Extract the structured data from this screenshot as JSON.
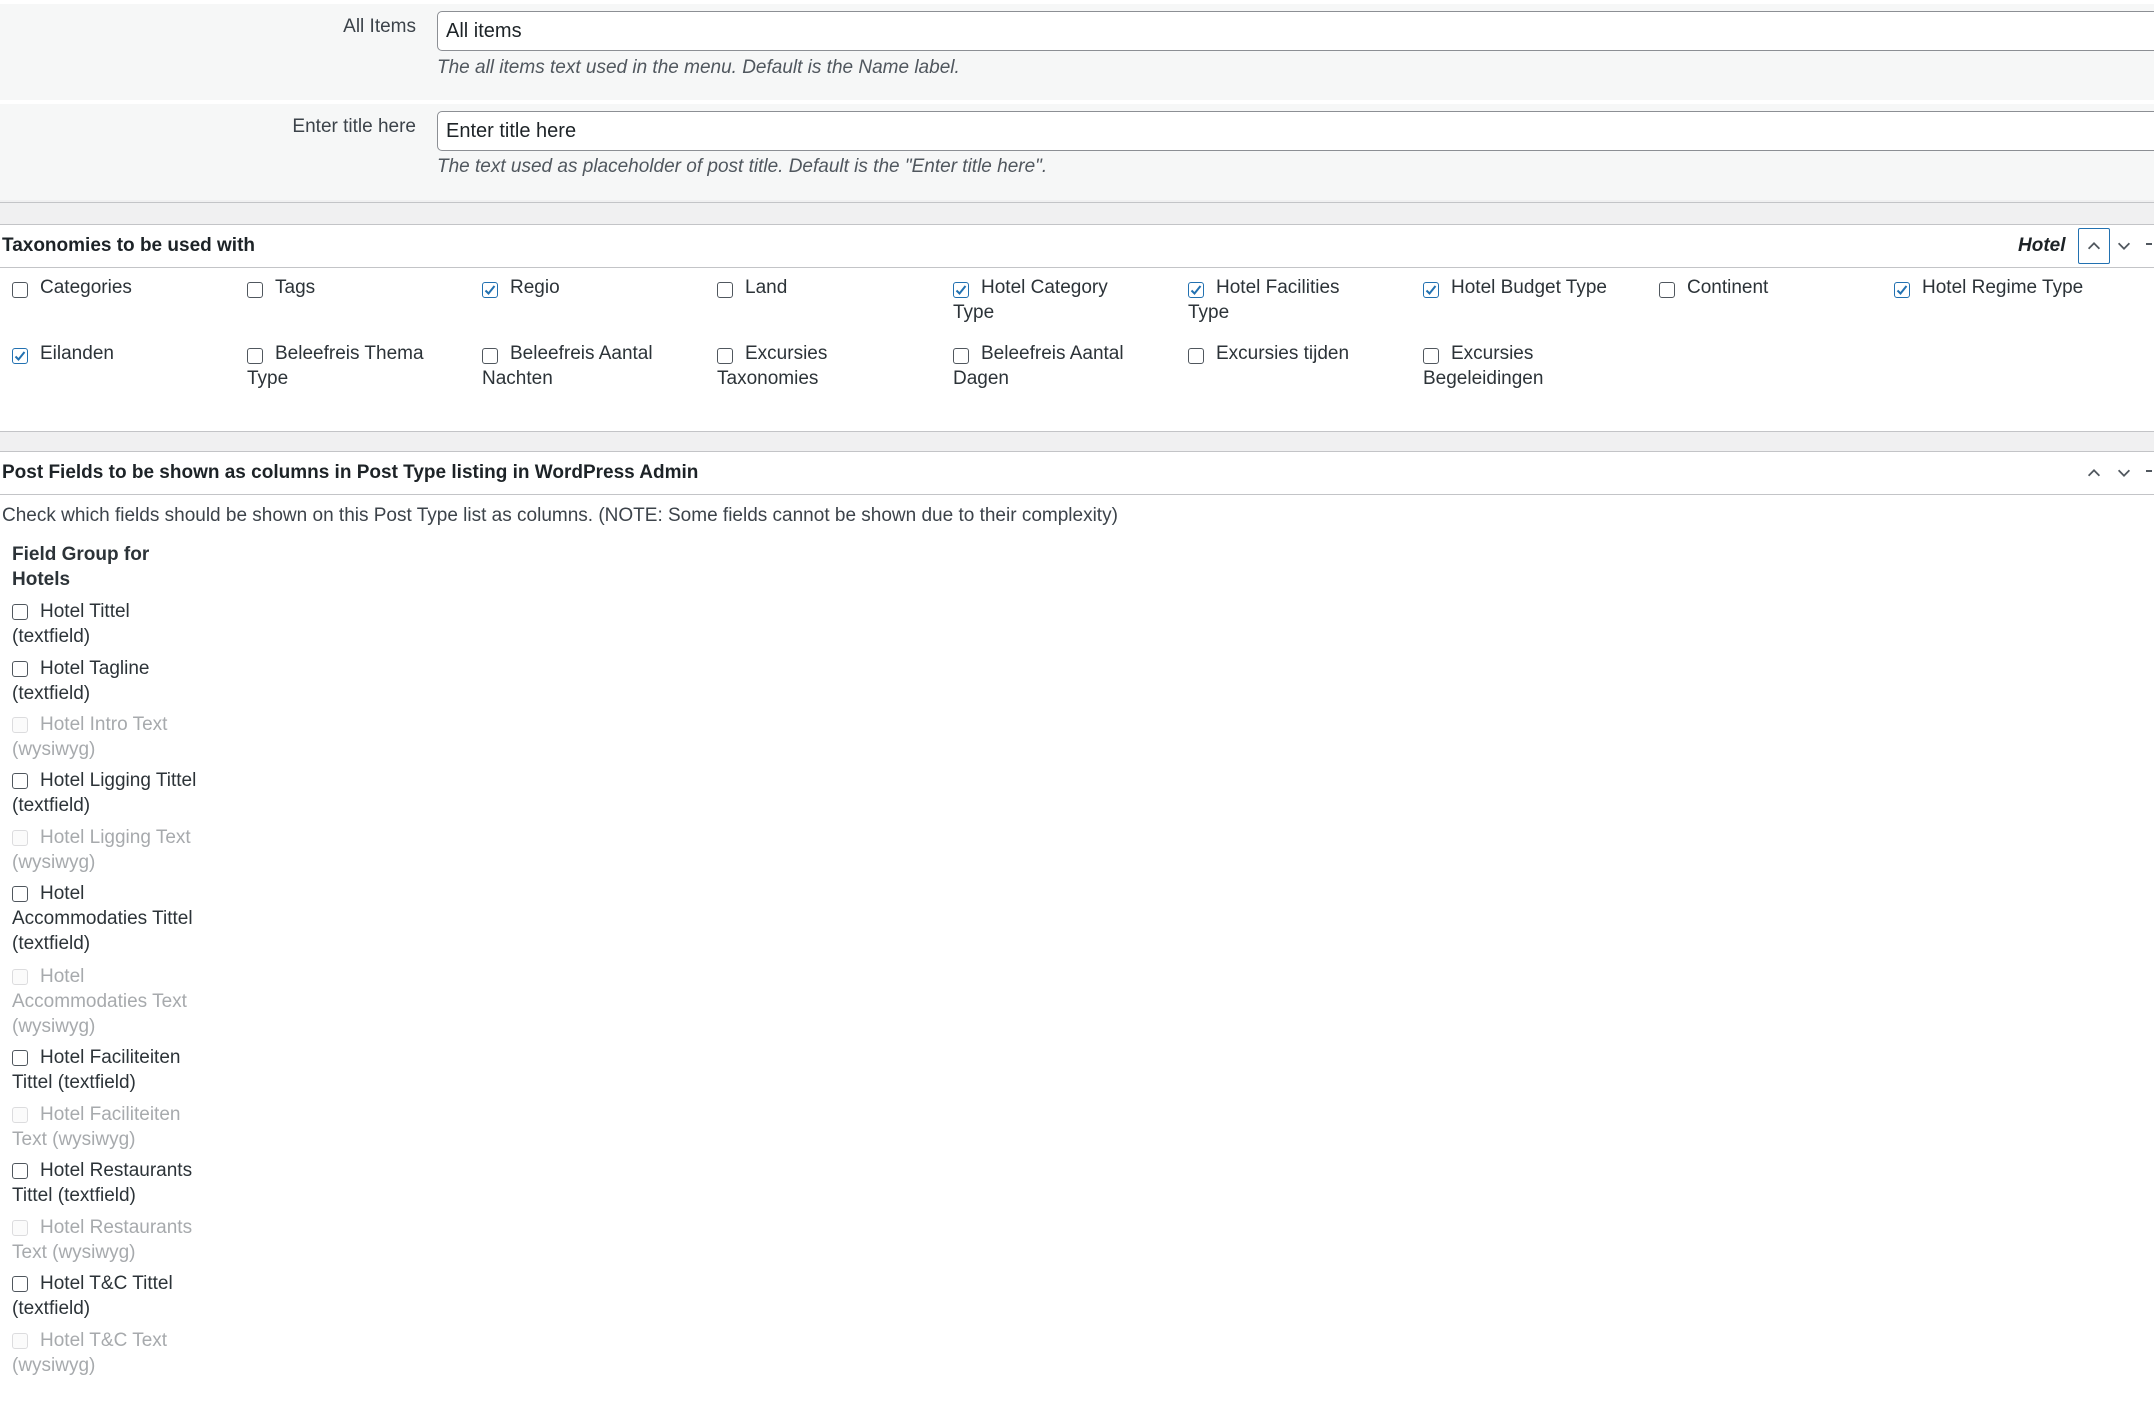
{
  "labels_section": {
    "all_items": {
      "label": "All Items",
      "value": "All items",
      "description": "The all items text used in the menu. Default is the Name label."
    },
    "enter_title": {
      "label": "Enter title here",
      "value": "Enter title here",
      "description": "The text used as placeholder of post title. Default is the \"Enter title here\"."
    }
  },
  "taxonomies": {
    "title": "Taxonomies to be used with",
    "post_type": "Hotel",
    "items": [
      {
        "label": "Categories",
        "checked": false
      },
      {
        "label": "Tags",
        "checked": false
      },
      {
        "label": "Regio",
        "checked": true
      },
      {
        "label": "Land",
        "checked": false
      },
      {
        "label": "Hotel Category Type",
        "checked": true
      },
      {
        "label": "Hotel Facilities Type",
        "checked": true
      },
      {
        "label": "Hotel Budget Type",
        "checked": true
      },
      {
        "label": "Continent",
        "checked": false
      },
      {
        "label": "Hotel Regime Type",
        "checked": true
      },
      {
        "label": "Eilanden",
        "checked": true
      },
      {
        "label": "Beleefreis Thema Type",
        "checked": false
      },
      {
        "label": "Beleefreis Aantal Nachten",
        "checked": false
      },
      {
        "label": "Excursies Taxonomies",
        "checked": false
      },
      {
        "label": "Beleefreis Aantal Dagen",
        "checked": false
      },
      {
        "label": "Excursies tijden",
        "checked": false
      },
      {
        "label": "Excursies Begeleidingen",
        "checked": false
      }
    ]
  },
  "post_fields": {
    "title": "Post Fields to be shown as columns in Post Type listing in WordPress Admin",
    "note": "Check which fields should be shown on this Post Type list as columns. (NOTE: Some fields cannot be shown due to their complexity)",
    "group_title": "Field Group for Hotels",
    "fields": [
      {
        "label": "Hotel Tittel (textfield)",
        "disabled": false
      },
      {
        "label": "Hotel Tagline (textfield)",
        "disabled": false
      },
      {
        "label": "Hotel Intro Text (wysiwyg)",
        "disabled": true
      },
      {
        "label": "Hotel Ligging Tittel (textfield)",
        "disabled": false
      },
      {
        "label": "Hotel Ligging Text (wysiwyg)",
        "disabled": true
      },
      {
        "label": "Hotel Accommodaties Tittel (textfield)",
        "disabled": false
      },
      {
        "label": "Hotel Accommodaties Text (wysiwyg)",
        "disabled": true
      },
      {
        "label": "Hotel Faciliteiten Tittel (textfield)",
        "disabled": false
      },
      {
        "label": "Hotel Faciliteiten Text (wysiwyg)",
        "disabled": true
      },
      {
        "label": "Hotel Restaurants Tittel (textfield)",
        "disabled": false
      },
      {
        "label": "Hotel Restaurants Text (wysiwyg)",
        "disabled": true
      },
      {
        "label": "Hotel T&C Tittel (textfield)",
        "disabled": false
      },
      {
        "label": "Hotel T&C Text (wysiwyg)",
        "disabled": true
      }
    ]
  },
  "colors": {
    "accent": "#2271b1",
    "background": "#f0f0f1",
    "text": "#1d2327",
    "disabled_text": "#a7aaad"
  }
}
